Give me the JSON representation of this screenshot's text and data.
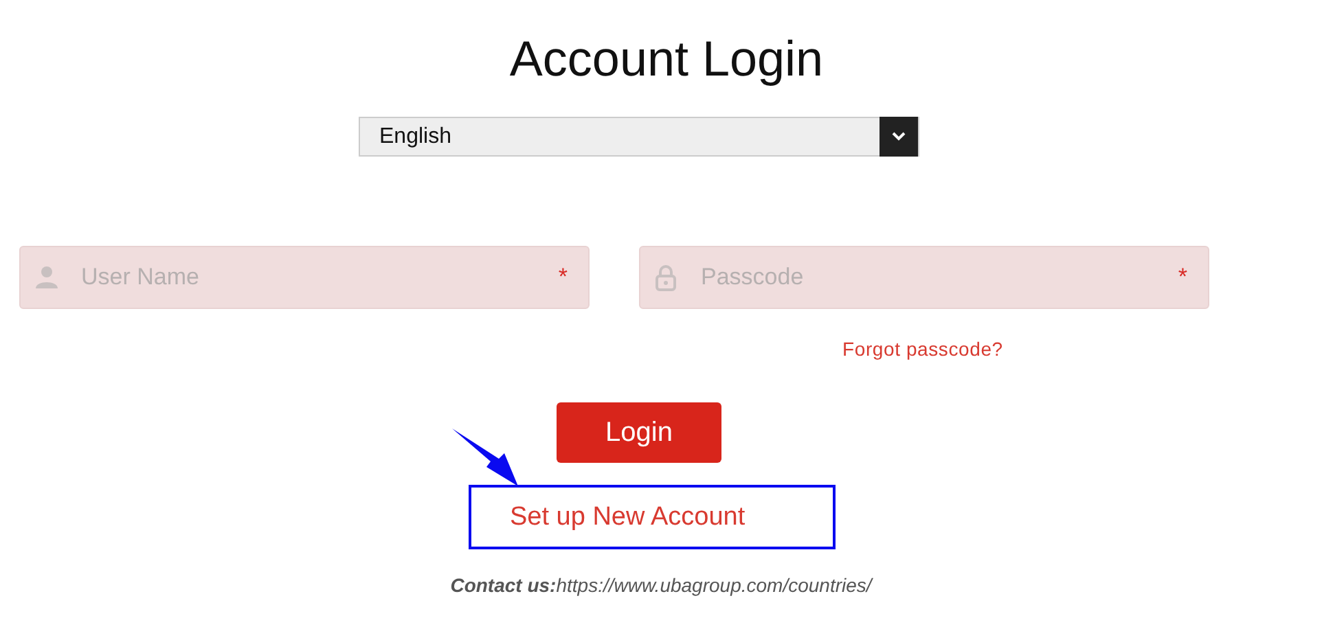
{
  "title": "Account Login",
  "language_select": {
    "value": "English"
  },
  "fields": [
    {
      "kind": "user",
      "placeholder": "User Name",
      "required": true,
      "required_mark": "*"
    },
    {
      "kind": "lock",
      "placeholder": "Passcode",
      "required": true,
      "required_mark": "*"
    }
  ],
  "forgot_link": "Forgot passcode?",
  "login_button": "Login",
  "signup_link": {
    "label": "Set up New Account",
    "highlighted": true
  },
  "contact": "**Contact us:**https://www.ubagroup.com/countries/"
}
